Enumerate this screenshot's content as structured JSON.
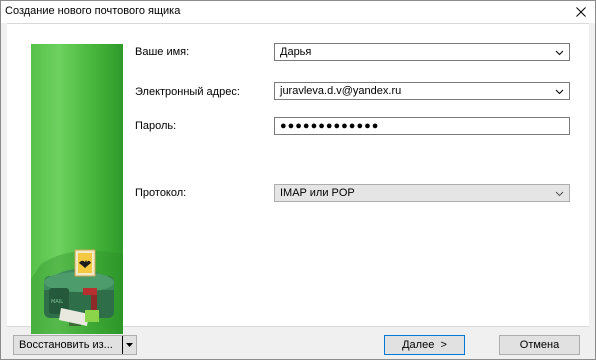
{
  "window": {
    "title": "Создание нового почтового ящика"
  },
  "form": {
    "name_label": "Ваше имя:",
    "name_value": "Дарья",
    "email_label": "Электронный адрес:",
    "email_value": "juravleva.d.v@yandex.ru",
    "password_label": "Пароль:",
    "password_value": "●●●●●●●●●●●●●",
    "protocol_label": "Протокол:",
    "protocol_value": "IMAP или POP"
  },
  "footer": {
    "restore_label": "Восстановить из...",
    "next_label": "Далее  >",
    "cancel_label": "Отмена"
  },
  "icons": {
    "close": "close-icon",
    "chevron": "chevron-down-icon",
    "mailbox": "mailbox-illustration"
  },
  "colors": {
    "banner_green": "#4ab73e",
    "primary_border": "#0078d7"
  }
}
